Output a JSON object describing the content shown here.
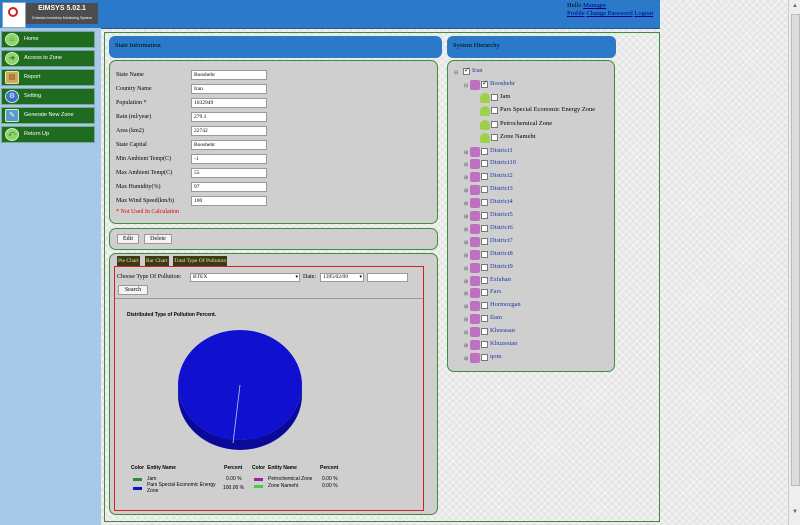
{
  "header": {
    "app_title": "EIMSYS 5.02.1",
    "app_subtitle": "Emission Inventory Monitoring System",
    "hello_prefix": "Hello",
    "username": "Manager",
    "link_profile": "Profile",
    "link_change_password": "Change Password",
    "link_logout": "Logout"
  },
  "sidebar": {
    "items": [
      {
        "label": "Home"
      },
      {
        "label": "Access to Zone"
      },
      {
        "label": "Report"
      },
      {
        "label": "Setting"
      },
      {
        "label": "Generate New Zone"
      },
      {
        "label": "Return Up"
      }
    ]
  },
  "state_info": {
    "title": "State Information",
    "fields": [
      {
        "label": "State Name",
        "value": "Booshehr"
      },
      {
        "label": "Country Name",
        "value": "Iran"
      },
      {
        "label": "Population *",
        "value": "1032949"
      },
      {
        "label": "Rain (ml/year)",
        "value": "279.1"
      },
      {
        "label": "Area (km2)",
        "value": "22742"
      },
      {
        "label": "State Capital",
        "value": "Booshehr"
      },
      {
        "label": "Min Ambient Temp(C)",
        "value": "-1"
      },
      {
        "label": "Max Ambient Temp(C)",
        "value": "55"
      },
      {
        "label": "Max Humidity(%)",
        "value": "97"
      },
      {
        "label": "Max Wind Speed(km/h)",
        "value": "100"
      }
    ],
    "note": "* Not Used In Calculation",
    "edit_label": "Edit",
    "delete_label": "Delete"
  },
  "chart_section": {
    "tabs": [
      "Pie Chart",
      "Bar Chart",
      "Total Type Of Pollution"
    ],
    "pollution_label": "Choose Type Of Pollution:",
    "pollution_value": "BTEX",
    "date_label": "Date:",
    "date_value": "1395/02/09",
    "search_label": "Search"
  },
  "chart_data": {
    "type": "pie",
    "title": "Distributed Type of Pollution Percent.",
    "legend_headers": {
      "color": "Color",
      "entity": "Entity Name",
      "percent": "Percent"
    },
    "slices": [
      {
        "name": "Jam",
        "percent_label": "0.00 %",
        "value": 0.0,
        "color": "#2e8b2e"
      },
      {
        "name": "Pars Special Economic Energy Zone",
        "percent_label": "100.00 %",
        "value": 100.0,
        "color": "#1010d0"
      },
      {
        "name": "Petrochemical Zone",
        "percent_label": "0.00 %",
        "value": 0.0,
        "color": "#a020a0"
      },
      {
        "name": "Zone Nameht",
        "percent_label": "0.00 %",
        "value": 0.0,
        "color": "#40d040"
      }
    ]
  },
  "hierarchy": {
    "title": "System Hierarchy",
    "root": "Iran",
    "items": [
      {
        "label": "Booshehr",
        "level": 1,
        "checked": true,
        "kind": "link"
      },
      {
        "label": "Jam",
        "level": 2,
        "checked": false,
        "kind": "leaf"
      },
      {
        "label": "Pars Special Economic Energy Zone",
        "level": 2,
        "checked": false,
        "kind": "leaf"
      },
      {
        "label": "Petrochemical Zone",
        "level": 2,
        "checked": false,
        "kind": "leaf"
      },
      {
        "label": "Zone Nameht",
        "level": 2,
        "checked": false,
        "kind": "leaf"
      },
      {
        "label": "District1",
        "level": 1,
        "checked": false,
        "kind": "link"
      },
      {
        "label": "District10",
        "level": 1,
        "checked": false,
        "kind": "link"
      },
      {
        "label": "District2",
        "level": 1,
        "checked": false,
        "kind": "link"
      },
      {
        "label": "District3",
        "level": 1,
        "checked": false,
        "kind": "link"
      },
      {
        "label": "District4",
        "level": 1,
        "checked": false,
        "kind": "link"
      },
      {
        "label": "District5",
        "level": 1,
        "checked": false,
        "kind": "link"
      },
      {
        "label": "District6",
        "level": 1,
        "checked": false,
        "kind": "link"
      },
      {
        "label": "District7",
        "level": 1,
        "checked": false,
        "kind": "link"
      },
      {
        "label": "District8",
        "level": 1,
        "checked": false,
        "kind": "link"
      },
      {
        "label": "District9",
        "level": 1,
        "checked": false,
        "kind": "link"
      },
      {
        "label": "Esfahan",
        "level": 1,
        "checked": false,
        "kind": "link"
      },
      {
        "label": "Fars",
        "level": 1,
        "checked": false,
        "kind": "link"
      },
      {
        "label": "Hormozgan",
        "level": 1,
        "checked": false,
        "kind": "link"
      },
      {
        "label": "Ilam",
        "level": 1,
        "checked": false,
        "kind": "link"
      },
      {
        "label": "Khorasan",
        "level": 1,
        "checked": false,
        "kind": "link"
      },
      {
        "label": "Khuzestan",
        "level": 1,
        "checked": false,
        "kind": "link"
      },
      {
        "label": "qom",
        "level": 1,
        "checked": false,
        "kind": "link"
      }
    ]
  }
}
